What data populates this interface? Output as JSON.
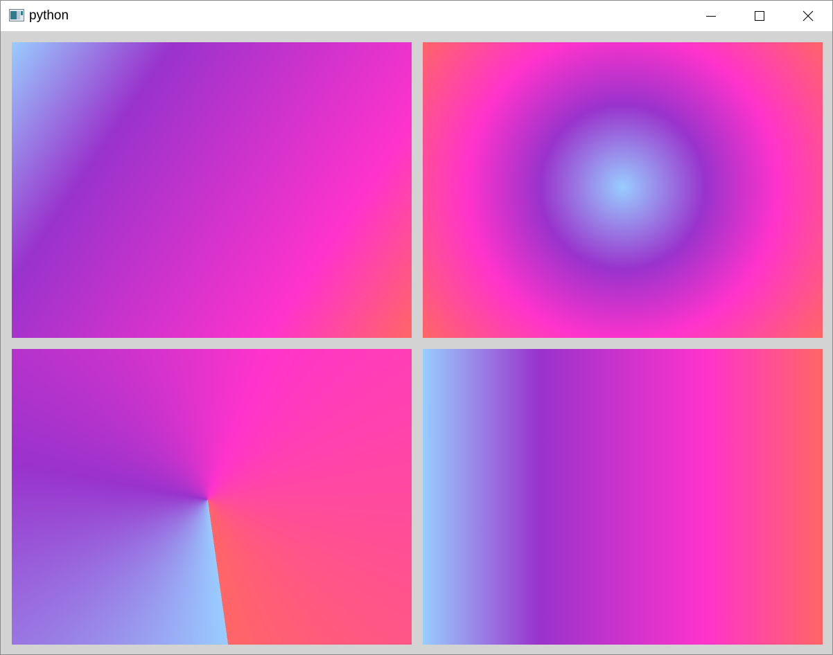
{
  "window": {
    "title": "python",
    "controls": [
      "minimize",
      "maximize",
      "close"
    ]
  },
  "icons": {
    "app": "python-app-icon",
    "minimize": "minimize-icon",
    "maximize": "maximize-icon",
    "close": "close-icon"
  },
  "colors": {
    "light_blue": "#99ccff",
    "purple": "#9933cc",
    "magenta": "#ff33cc",
    "coral": "#ff6666",
    "window_background": "#d3d3d3"
  },
  "panels": [
    {
      "id": "top-left",
      "gradient": "linear",
      "direction": "diagonal"
    },
    {
      "id": "top-right",
      "gradient": "radial"
    },
    {
      "id": "bottom-left",
      "gradient": "conical"
    },
    {
      "id": "bottom-right",
      "gradient": "linear",
      "direction": "horizontal"
    }
  ]
}
